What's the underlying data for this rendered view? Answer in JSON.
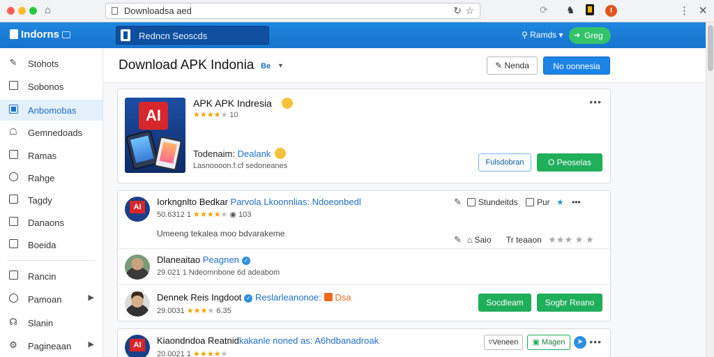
{
  "browser": {
    "url": "Downloadsa aed",
    "colors": {
      "close": "#ff5f57",
      "minimize": "#febc2e",
      "maximize": "#28c840"
    },
    "ext4_label": "I"
  },
  "header": {
    "brand": "Indorns",
    "search_text": "Redncn Seoscds",
    "account": "Ramds",
    "greet": "Greg",
    "accent": "#1f86e0"
  },
  "sidebar": {
    "items": [
      {
        "label": "Stohots",
        "icon": "edit-icon"
      },
      {
        "label": "Sobonos",
        "icon": "book-icon"
      },
      {
        "label": "Anbomobas",
        "icon": "apps-icon",
        "active": true
      },
      {
        "label": "Gemnedoads",
        "icon": "game-icon"
      },
      {
        "label": "Ramas",
        "icon": "box-icon"
      },
      {
        "label": "Rahge",
        "icon": "clock-icon"
      },
      {
        "label": "Tagdy",
        "icon": "lock-icon"
      },
      {
        "label": "Danaons",
        "icon": "image-icon"
      },
      {
        "label": "Boeida",
        "icon": "camera-icon"
      },
      {
        "label": "Rancin",
        "icon": "square-icon"
      },
      {
        "label": "Pamoan",
        "icon": "target-icon"
      },
      {
        "label": "Slanin",
        "icon": "user-icon"
      },
      {
        "label": "Pagineaan",
        "icon": "settings-icon"
      }
    ]
  },
  "main": {
    "title": "Download APK Indonia",
    "beta": "Be",
    "btn_outline": "Nenda",
    "btn_primary": "No oonnesia"
  },
  "app": {
    "name": "APK APK Indresia",
    "rating_count": "10",
    "dev_prefix": "Todenaim:",
    "dev_name": "Dealank",
    "package": "Lasnoooon.f.cf sedoneanes",
    "btn_ghost": "Fulsdobran",
    "btn_green": "O Peoselas"
  },
  "reviews": [
    {
      "title_a": "Iorkngnlto Bedkar",
      "title_b": "Parvola Lkoonnlias:",
      "title_c": "Ndoeonbedl",
      "meta_date": "50.6312 1",
      "meta_count": "103",
      "body": "Umeeng tekalea moo bdvarakeme",
      "actions_1": "Stundeitds",
      "actions_2": "Pur",
      "actions_3": "Saio",
      "actions_4": "Tr teaaon"
    },
    {
      "title_a": "Dlaneaitao",
      "title_b": "Peagnen",
      "meta": "29.021 1 Ndeomnbone 6d adeabom"
    },
    {
      "title_a": "Dennek Reis Ingdoot",
      "title_b": "Reslarleanonoe:",
      "title_c": "Dsa",
      "meta_date": "29.0031",
      "meta_count": "6.35",
      "btn_1": "Socdleam",
      "btn_2": "Sogbr Reano"
    }
  ],
  "bottom": {
    "title_a": "Kiaondndoa Reatnid",
    "title_b": "kakanle noned as:",
    "title_c": "A6hdbanadroak",
    "meta": "20.0021 1",
    "btn_1": "Veneen",
    "btn_2": "Magen"
  }
}
